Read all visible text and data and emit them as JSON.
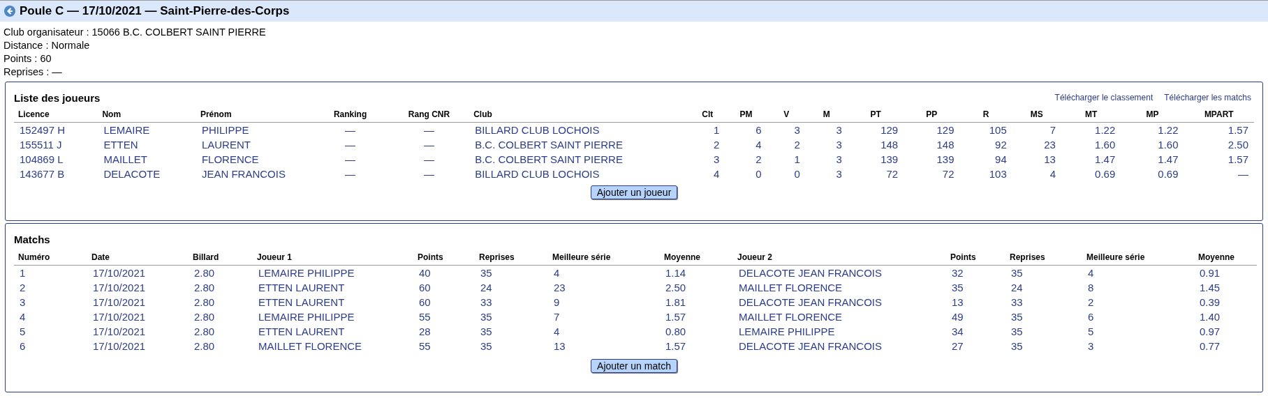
{
  "header": {
    "title": "Poule C — 17/10/2021 — Saint-Pierre-des-Corps"
  },
  "info": [
    "Club organisateur : 15066 B.C. COLBERT SAINT PIERRE",
    "Distance : Normale",
    "Points : 60",
    "Reprises : —"
  ],
  "players": {
    "title": "Liste des joueurs",
    "links": [
      "Télécharger le classement",
      "Télécharger les matchs"
    ],
    "columns": [
      "Licence",
      "Nom",
      "Prénom",
      "Ranking",
      "Rang CNR",
      "Club",
      "Clt",
      "PM",
      "V",
      "M",
      "PT",
      "PP",
      "R",
      "MS",
      "MT",
      "MP",
      "MPART"
    ],
    "rows": [
      [
        "152497 H",
        "LEMAIRE",
        "PHILIPPE",
        "—",
        "—",
        "BILLARD CLUB LOCHOIS",
        "1",
        "6",
        "3",
        "3",
        "129",
        "129",
        "105",
        "7",
        "1.22",
        "1.22",
        "1.57"
      ],
      [
        "155511 J",
        "ETTEN",
        "LAURENT",
        "—",
        "—",
        "B.C. COLBERT SAINT PIERRE",
        "2",
        "4",
        "2",
        "3",
        "148",
        "148",
        "92",
        "23",
        "1.60",
        "1.60",
        "2.50"
      ],
      [
        "104869 L",
        "MAILLET",
        "FLORENCE",
        "—",
        "—",
        "B.C. COLBERT SAINT PIERRE",
        "3",
        "2",
        "1",
        "3",
        "139",
        "139",
        "94",
        "13",
        "1.47",
        "1.47",
        "1.57"
      ],
      [
        "143677 B",
        "DELACOTE",
        "JEAN FRANCOIS",
        "—",
        "—",
        "BILLARD CLUB LOCHOIS",
        "4",
        "0",
        "0",
        "3",
        "72",
        "72",
        "103",
        "4",
        "0.69",
        "0.69",
        "—"
      ]
    ],
    "button": "Ajouter un joueur"
  },
  "matches": {
    "title": "Matchs",
    "columns": [
      "Numéro",
      "Date",
      "Billard",
      "Joueur 1",
      "Points",
      "Reprises",
      "Meilleure série",
      "Moyenne",
      "Joueur 2",
      "Points",
      "Reprises",
      "Meilleure série",
      "Moyenne"
    ],
    "rows": [
      [
        "1",
        "17/10/2021",
        "2.80",
        "LEMAIRE PHILIPPE",
        "40",
        "35",
        "4",
        "1.14",
        "DELACOTE JEAN FRANCOIS",
        "32",
        "35",
        "4",
        "0.91"
      ],
      [
        "2",
        "17/10/2021",
        "2.80",
        "ETTEN LAURENT",
        "60",
        "24",
        "23",
        "2.50",
        "MAILLET FLORENCE",
        "35",
        "24",
        "8",
        "1.45"
      ],
      [
        "3",
        "17/10/2021",
        "2.80",
        "ETTEN LAURENT",
        "60",
        "33",
        "9",
        "1.81",
        "DELACOTE JEAN FRANCOIS",
        "13",
        "33",
        "2",
        "0.39"
      ],
      [
        "4",
        "17/10/2021",
        "2.80",
        "LEMAIRE PHILIPPE",
        "55",
        "35",
        "7",
        "1.57",
        "MAILLET FLORENCE",
        "49",
        "35",
        "6",
        "1.40"
      ],
      [
        "5",
        "17/10/2021",
        "2.80",
        "ETTEN LAURENT",
        "28",
        "35",
        "4",
        "0.80",
        "LEMAIRE PHILIPPE",
        "34",
        "35",
        "5",
        "0.97"
      ],
      [
        "6",
        "17/10/2021",
        "2.80",
        "MAILLET FLORENCE",
        "55",
        "35",
        "13",
        "1.57",
        "DELACOTE JEAN FRANCOIS",
        "27",
        "35",
        "3",
        "0.77"
      ]
    ],
    "button": "Ajouter un match"
  }
}
